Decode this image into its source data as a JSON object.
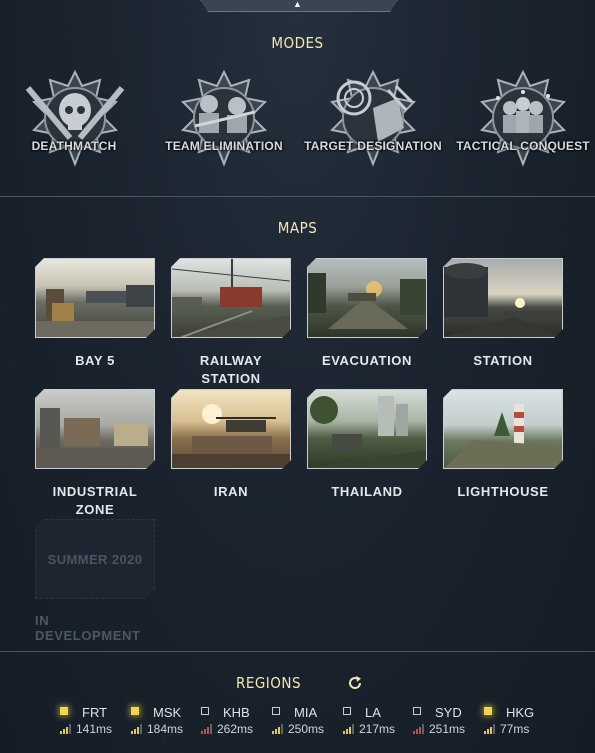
{
  "modes_title": "MODES",
  "maps_title": "MAPS",
  "regions_title": "REGIONS",
  "modes": [
    {
      "label": "DEATHMATCH",
      "icon": "skull-rifles-icon"
    },
    {
      "label": "TEAM ELIMINATION",
      "icon": "soldiers-icon"
    },
    {
      "label": "TARGET DESIGNATION",
      "icon": "target-grenade-icon"
    },
    {
      "label": "TACTICAL CONQUEST",
      "icon": "squad-icon"
    }
  ],
  "maps": [
    {
      "name": "BAY 5",
      "theme": "bay"
    },
    {
      "name": "RAILWAY STATION",
      "theme": "railway"
    },
    {
      "name": "EVACUATION",
      "theme": "evac"
    },
    {
      "name": "STATION",
      "theme": "station"
    },
    {
      "name": "INDUSTRIAL ZONE",
      "theme": "industrial"
    },
    {
      "name": "IRAN",
      "theme": "iran"
    },
    {
      "name": "THAILAND",
      "theme": "thailand"
    },
    {
      "name": "LIGHTHOUSE",
      "theme": "lighthouse"
    }
  ],
  "dev_map": {
    "thumb_label": "SUMMER 2020",
    "status": "IN DEVELOPMENT"
  },
  "regions": [
    {
      "code": "FRT",
      "ping": "141ms",
      "selected": true,
      "signal_color": "#e8c84a"
    },
    {
      "code": "MSK",
      "ping": "184ms",
      "selected": true,
      "signal_color": "#e8c84a"
    },
    {
      "code": "KHB",
      "ping": "262ms",
      "selected": false,
      "signal_color": "#c94a4a"
    },
    {
      "code": "MIA",
      "ping": "250ms",
      "selected": false,
      "signal_color": "#e8c84a"
    },
    {
      "code": "LA",
      "ping": "217ms",
      "selected": false,
      "signal_color": "#e8c84a"
    },
    {
      "code": "SYD",
      "ping": "251ms",
      "selected": false,
      "signal_color": "#c94a4a"
    },
    {
      "code": "HKG",
      "ping": "77ms",
      "selected": true,
      "signal_color": "#e8c84a"
    }
  ]
}
